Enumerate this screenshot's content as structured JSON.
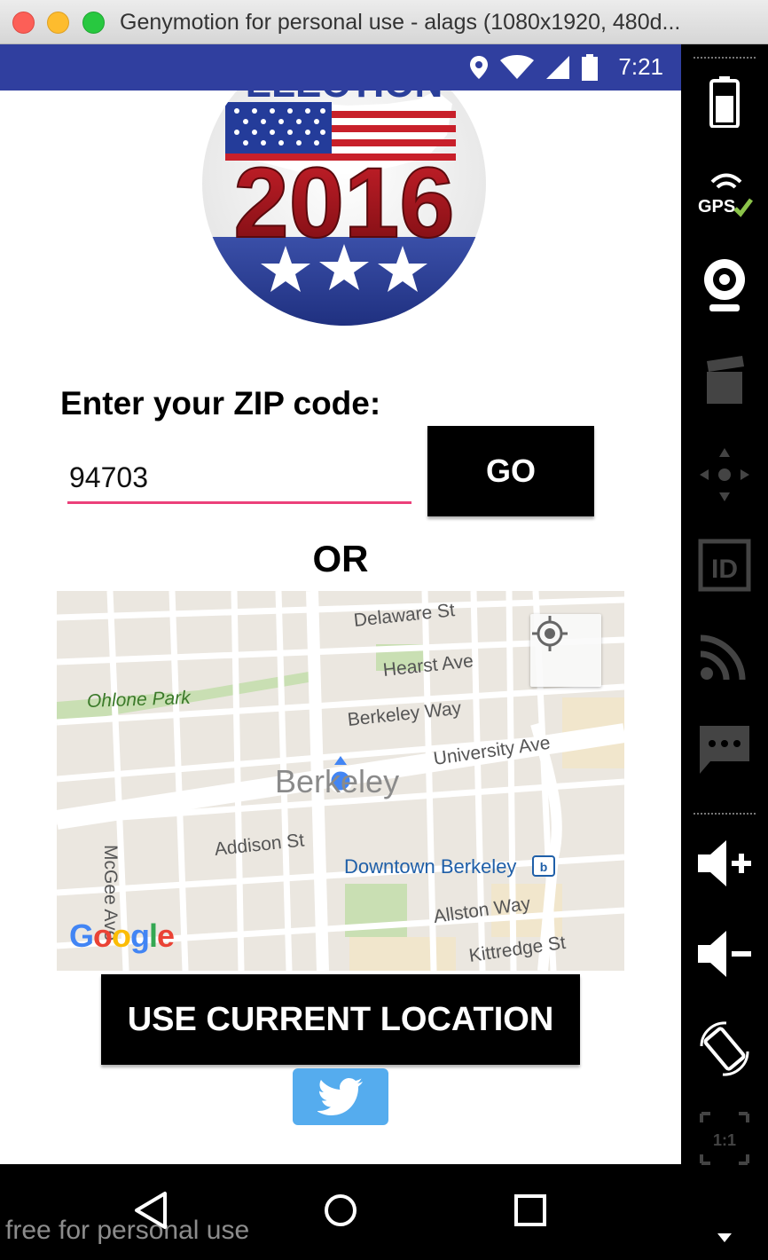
{
  "window": {
    "title": "Genymotion for personal use - alags (1080x1920, 480d..."
  },
  "statusbar": {
    "time": "7:21",
    "icons": [
      "location-icon",
      "wifi-icon",
      "signal-icon",
      "battery-icon"
    ]
  },
  "app": {
    "logo": {
      "top_text": "ELECTION",
      "year": "2016"
    },
    "zip_label": "Enter your ZIP code:",
    "zip_value": "94703",
    "go_label": "GO",
    "or_label": "OR",
    "map": {
      "streets": [
        "Delaware St",
        "Hearst Ave",
        "Berkeley Way",
        "University Ave",
        "Addison St",
        "Allston Way",
        "Kittredge St",
        "McGee Ave"
      ],
      "park": "Ohlone Park",
      "city": "Berkeley",
      "station": "Downtown Berkeley",
      "google_logo": "Google"
    },
    "use_location_label": "USE CURRENT LOCATION",
    "twitter_icon": "twitter-icon"
  },
  "watermark": "free for personal use",
  "colors": {
    "statusbar": "#303f9f",
    "input_underline": "#ec407a",
    "twitter": "#55acee",
    "button": "#000000"
  },
  "sidepanel": {
    "gps_label": "GPS",
    "scale_label": "1:1"
  }
}
